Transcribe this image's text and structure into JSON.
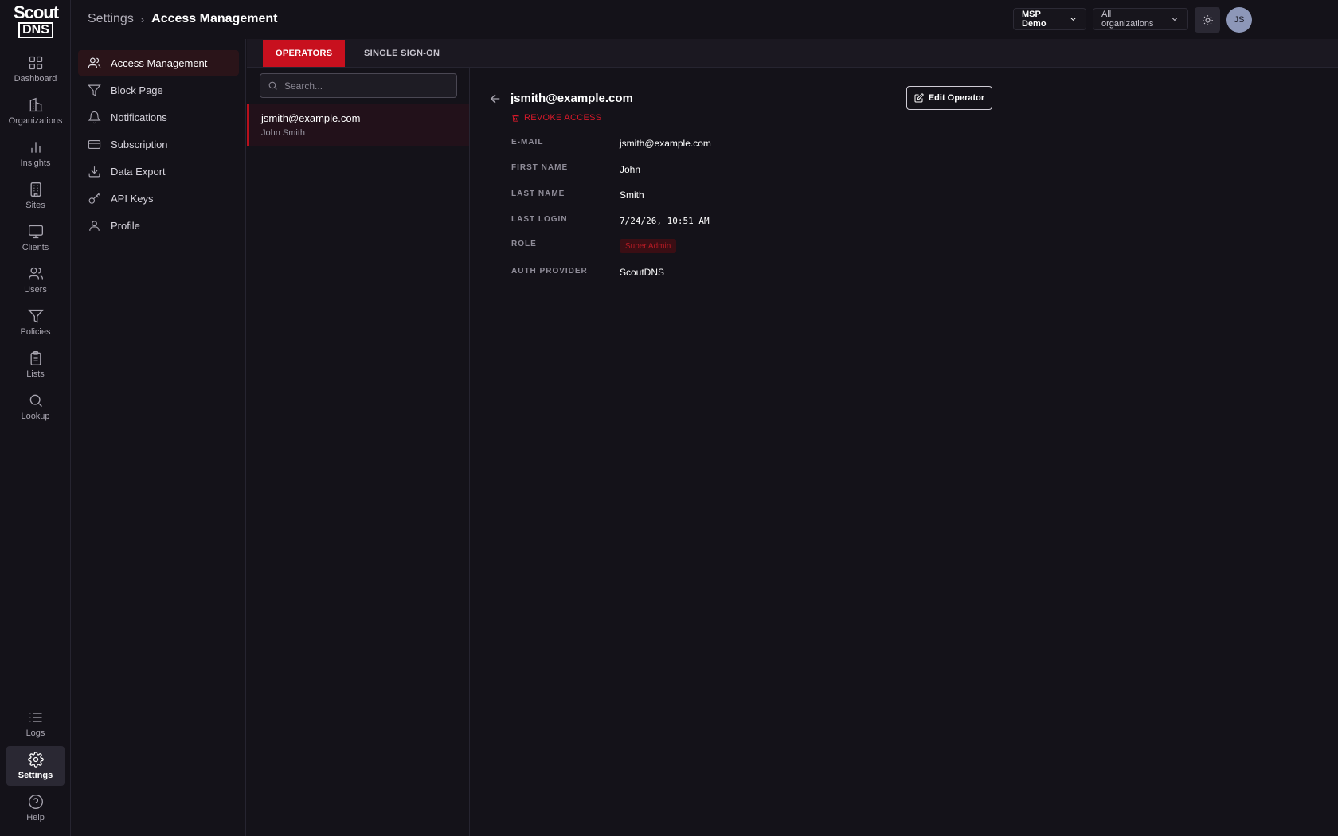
{
  "brand": {
    "line1": "Scout",
    "line2": "DNS"
  },
  "rail": {
    "items": [
      {
        "label": "Dashboard",
        "icon": "dashboard-icon"
      },
      {
        "label": "Organizations",
        "icon": "building-icon"
      },
      {
        "label": "Insights",
        "icon": "bar-chart-icon"
      },
      {
        "label": "Sites",
        "icon": "site-building-icon"
      },
      {
        "label": "Clients",
        "icon": "monitor-icon"
      },
      {
        "label": "Users",
        "icon": "users-icon"
      },
      {
        "label": "Policies",
        "icon": "filter-icon"
      },
      {
        "label": "Lists",
        "icon": "clipboard-icon"
      },
      {
        "label": "Lookup",
        "icon": "search-icon"
      }
    ],
    "bottom": [
      {
        "label": "Logs",
        "icon": "list-icon"
      },
      {
        "label": "Settings",
        "icon": "gear-icon",
        "active": true
      },
      {
        "label": "Help",
        "icon": "help-icon"
      }
    ]
  },
  "header": {
    "breadcrumb_root": "Settings",
    "breadcrumb_current": "Access Management",
    "msp_select": "MSP Demo",
    "org_select": "All organizations",
    "avatar_initials": "JS"
  },
  "settings_nav": {
    "items": [
      {
        "label": "Access Management",
        "icon": "users-icon",
        "active": true
      },
      {
        "label": "Block Page",
        "icon": "filter-icon"
      },
      {
        "label": "Notifications",
        "icon": "bell-icon"
      },
      {
        "label": "Subscription",
        "icon": "credit-card-icon"
      },
      {
        "label": "Data Export",
        "icon": "download-icon"
      },
      {
        "label": "API Keys",
        "icon": "key-icon"
      },
      {
        "label": "Profile",
        "icon": "user-icon"
      }
    ]
  },
  "tabs": {
    "operators": "OPERATORS",
    "sso": "SINGLE SIGN-ON"
  },
  "list": {
    "search_placeholder": "Search...",
    "operators": [
      {
        "email": "jsmith@example.com",
        "name": "John Smith"
      }
    ]
  },
  "detail": {
    "title": "jsmith@example.com",
    "revoke_label": "REVOKE ACCESS",
    "edit_label": "Edit Operator",
    "fields": {
      "email": {
        "label": "E-MAIL",
        "value": "jsmith@example.com"
      },
      "first_name": {
        "label": "FIRST NAME",
        "value": "John"
      },
      "last_name": {
        "label": "LAST NAME",
        "value": "Smith"
      },
      "last_login": {
        "label": "LAST LOGIN",
        "value": "7/24/26, 10:51 AM"
      },
      "role": {
        "label": "ROLE",
        "value": "Super Admin"
      },
      "auth_provider": {
        "label": "AUTH PROVIDER",
        "value": "ScoutDNS"
      }
    }
  },
  "colors": {
    "accent": "#c8101e",
    "background": "#141219",
    "role_badge_bg": "#3a0e14"
  }
}
